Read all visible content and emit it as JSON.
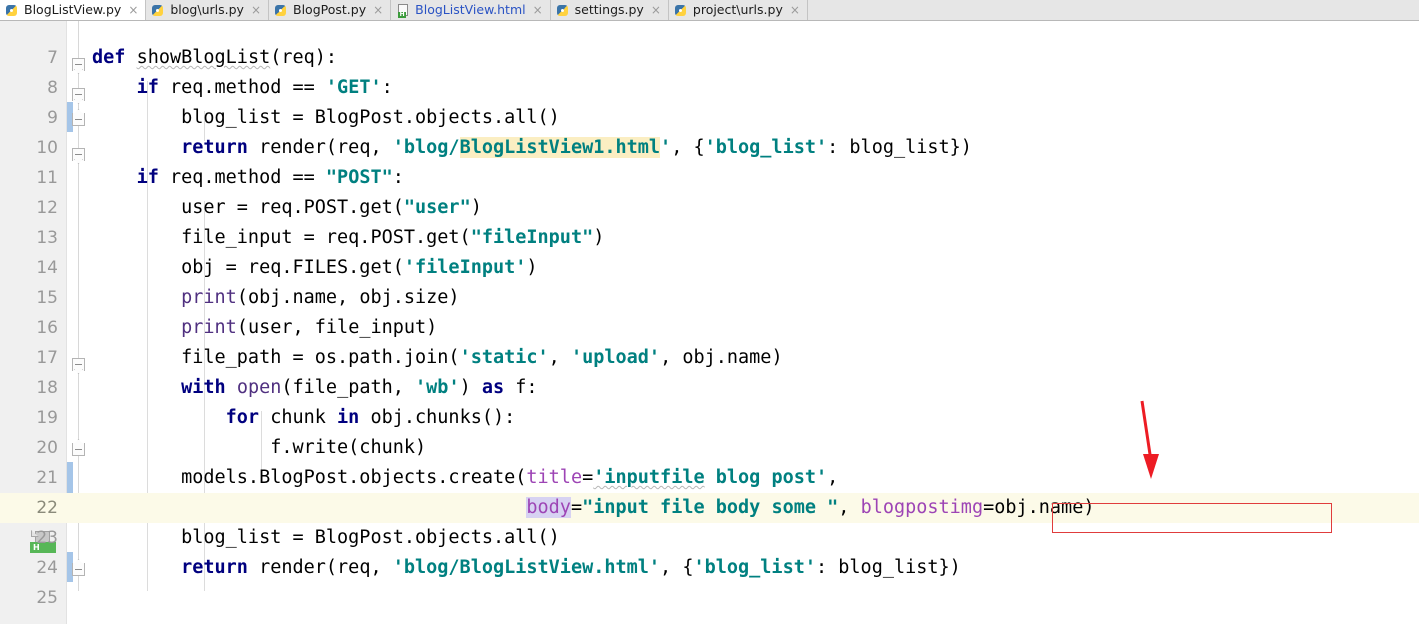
{
  "window": {
    "app": "PyCharm Editor",
    "active_file": "BlogListView.py"
  },
  "tabs": [
    {
      "label": "BlogListView.py",
      "icon": "python-file-icon",
      "close": "×",
      "selected": true,
      "highlighted": false
    },
    {
      "label": "blog\\urls.py",
      "icon": "python-file-icon",
      "close": "×",
      "selected": false,
      "highlighted": false
    },
    {
      "label": "BlogPost.py",
      "icon": "python-file-icon",
      "close": "×",
      "selected": false,
      "highlighted": false
    },
    {
      "label": "BlogListView.html",
      "icon": "html-file-icon",
      "close": "×",
      "selected": false,
      "highlighted": true
    },
    {
      "label": "settings.py",
      "icon": "python-file-icon",
      "close": "×",
      "selected": false,
      "highlighted": false
    },
    {
      "label": "project\\urls.py",
      "icon": "python-file-icon",
      "close": "×",
      "selected": false,
      "highlighted": false
    }
  ],
  "editor": {
    "language": "Python",
    "first_line_number": 7,
    "current_line_number": 22,
    "gutter_marker": {
      "name": "html-bookmark-marker",
      "badge": "H",
      "line": 24
    },
    "lines": [
      {
        "n": "7",
        "text": "def showBlogList(req):"
      },
      {
        "n": "8",
        "text": "    if req.method == 'GET':"
      },
      {
        "n": "9",
        "text": "        blog_list = BlogPost.objects.all()"
      },
      {
        "n": "10",
        "text": "        return render(req, 'blog/BlogListView1.html', {'blog_list': blog_list})"
      },
      {
        "n": "11",
        "text": "    if req.method == \"POST\":"
      },
      {
        "n": "12",
        "text": "        user = req.POST.get(\"user\")"
      },
      {
        "n": "13",
        "text": "        file_input = req.POST.get(\"fileInput\")"
      },
      {
        "n": "14",
        "text": "        obj = req.FILES.get('fileInput')"
      },
      {
        "n": "15",
        "text": "        print(obj.name, obj.size)"
      },
      {
        "n": "16",
        "text": "        print(user, file_input)"
      },
      {
        "n": "17",
        "text": "        file_path = os.path.join('static', 'upload', obj.name)"
      },
      {
        "n": "18",
        "text": "        with open(file_path, 'wb') as f:"
      },
      {
        "n": "19",
        "text": "            for chunk in obj.chunks():"
      },
      {
        "n": "20",
        "text": "                f.write(chunk)"
      },
      {
        "n": "21",
        "text": "        models.BlogPost.objects.create(title='inputfile blog post',"
      },
      {
        "n": "22",
        "text": "                                       body=\"input file body some \", blogpostimg=obj.name)"
      },
      {
        "n": "23",
        "text": "        blog_list = BlogPost.objects.all()"
      },
      {
        "n": "24",
        "text": "        return render(req, 'blog/BlogListView.html', {'blog_list': blog_list})"
      },
      {
        "n": "25",
        "text": ""
      }
    ]
  },
  "annotations": {
    "red_box": {
      "name": "highlight-box",
      "target_text": "blogpostimg=obj.name",
      "color": "#e03c3c"
    },
    "red_arrow": {
      "name": "pointer-arrow",
      "direction": "down",
      "color": "#ed1c24"
    }
  },
  "colors": {
    "keyword": "#00007f",
    "string": "#008080",
    "function": "#503080",
    "kwarg": "#9d44b5",
    "current_line_bg": "#fcfae8",
    "search_highlight_bg": "#fbeec2",
    "identifier_highlight_bg": "#d7d2f2",
    "gutter_bg": "#f0f0f0",
    "change_bar": "#a5c5e8"
  }
}
